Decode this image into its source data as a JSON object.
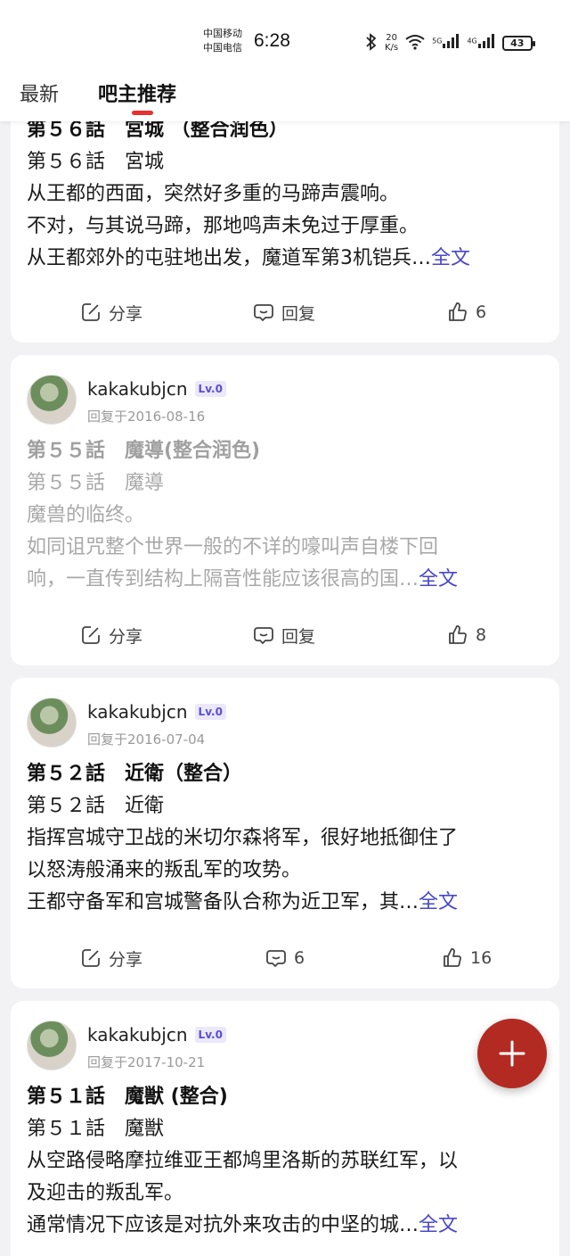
{
  "status_bar": {
    "carrier_1": "中国移动",
    "carrier_2": "中国电信",
    "time": "6:28",
    "net_speed_value": "20",
    "net_speed_unit": "K/s",
    "signal_1_label": "5G",
    "signal_2_label": "4G",
    "battery": "43"
  },
  "tabs": {
    "latest": "最新",
    "recommended": "吧主推荐",
    "active_color": "#e8302f"
  },
  "posts": [
    {
      "title": "第５６話　宮城 （整合润色）",
      "lines": [
        "第５６話　宮城",
        "从王都的西面，突然好多重的马蹄声震响。",
        "不对，与其说马蹄，那地鸣声未免过于厚重。",
        "从王都郊外的屯驻地出发，魔道军第3机铠兵…"
      ],
      "more": "全文",
      "share": "分享",
      "reply": "回复",
      "likes": "6"
    },
    {
      "author": "kakakubjcn",
      "level": "Lv.0",
      "date": "回复于2016-08-16",
      "title": "第５５話　魔導(整合润色)",
      "lines": [
        "第５５話　魔導",
        "魔兽的临终。",
        "如同诅咒整个世界一般的不详的嚎叫声自楼下回",
        "响，一直传到结构上隔音性能应该很高的国…"
      ],
      "more": "全文",
      "share": "分享",
      "reply": "回复",
      "likes": "8"
    },
    {
      "author": "kakakubjcn",
      "level": "Lv.0",
      "date": "回复于2016-07-04",
      "title": "第５２話　近衛（整合）",
      "lines": [
        "第５２話　近衛",
        "指挥宫城守卫战的米切尔森将军，很好地抵御住了",
        "以怒涛般涌来的叛乱军的攻势。",
        "王都守备军和宫城警备队合称为近卫军，其…"
      ],
      "more": "全文",
      "share": "分享",
      "reply": "6",
      "likes": "16"
    },
    {
      "author": "kakakubjcn",
      "level": "Lv.0",
      "date": "回复于2017-10-21",
      "title": "第５１話　魔獣 (整合)",
      "lines": [
        "第５１話　魔獣",
        "从空路侵略摩拉维亚王都鸠里洛斯的苏联红军，以",
        "及迎击的叛乱军。",
        "通常情况下应该是对抗外来攻击的中坚的城…"
      ],
      "more": "全文"
    }
  ],
  "fab_color": "#b32a22",
  "icons": {
    "share": "edit-share-icon",
    "reply": "comment-icon",
    "like": "thumbs-up-icon",
    "fab": "plus-icon"
  }
}
